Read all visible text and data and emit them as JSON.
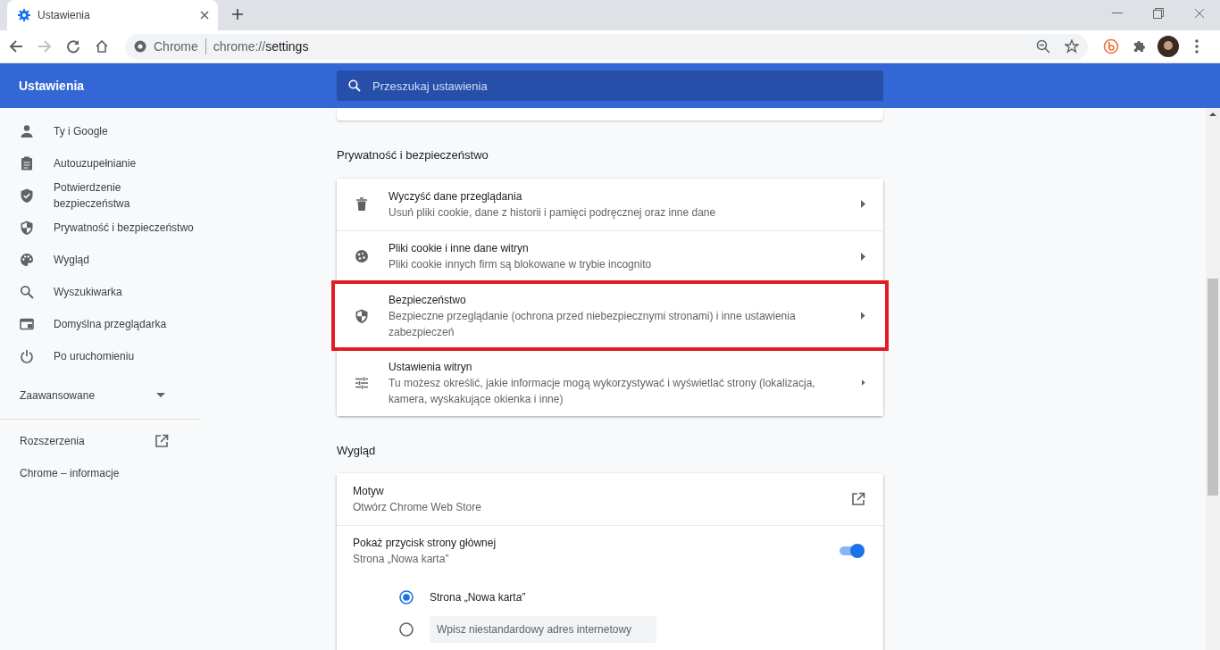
{
  "browser": {
    "tab": {
      "title": "Ustawienia",
      "selected": true
    },
    "address": {
      "origin": "Chrome",
      "url_scheme": "chrome://",
      "url_path": "settings"
    }
  },
  "header": {
    "title": "Ustawienia",
    "search": {
      "placeholder": "Przeszukaj ustawienia"
    }
  },
  "sidebar": {
    "items": [
      {
        "label": "Ty i Google"
      },
      {
        "label": "Autouzupełnianie"
      },
      {
        "label": "Potwierdzenie bezpieczeństwa"
      },
      {
        "label": "Prywatność i bezpieczeństwo"
      },
      {
        "label": "Wygląd"
      },
      {
        "label": "Wyszukiwarka"
      },
      {
        "label": "Domyślna przeglądarka"
      },
      {
        "label": "Po uruchomieniu"
      }
    ],
    "advanced": {
      "label": "Zaawansowane",
      "expanded": false
    },
    "links": [
      {
        "label": "Rozszerzenia",
        "external": true
      },
      {
        "label": "Chrome – informacje",
        "external": false
      }
    ]
  },
  "sections": [
    {
      "title": "Prywatność i bezpieczeństwo",
      "rows": [
        {
          "kind": "nav",
          "title": "Wyczyść dane przeglądania",
          "subtitle": "Usuń pliki cookie, dane z historii i pamięci podręcznej oraz inne dane",
          "highlighted": false
        },
        {
          "kind": "nav",
          "title": "Pliki cookie i inne dane witryn",
          "subtitle": "Pliki cookie innych firm są blokowane w trybie incognito",
          "highlighted": false
        },
        {
          "kind": "nav",
          "title": "Bezpieczeństwo",
          "subtitle": "Bezpieczne przeglądanie (ochrona przed niebezpiecznymi stronami) i inne ustawienia zabezpieczeń",
          "highlighted": true
        },
        {
          "kind": "nav",
          "title": "Ustawienia witryn",
          "subtitle": "Tu możesz określić, jakie informacje mogą wykorzystywać i wyświetlać strony (lokalizacja, kamera, wyskakujące okienka i inne)",
          "highlighted": false
        }
      ]
    },
    {
      "title": "Wygląd",
      "rows": [
        {
          "kind": "external",
          "title": "Motyw",
          "subtitle": "Otwórz Chrome Web Store"
        },
        {
          "kind": "toggle",
          "title": "Pokaż przycisk strony głównej",
          "subtitle": "Strona „Nowa karta”",
          "on": true,
          "options": [
            {
              "label": "Strona „Nowa karta”",
              "selected": true
            },
            {
              "placeholder": "Wpisz niestandardowy adres internetowy",
              "selected": false
            }
          ]
        }
      ]
    }
  ]
}
